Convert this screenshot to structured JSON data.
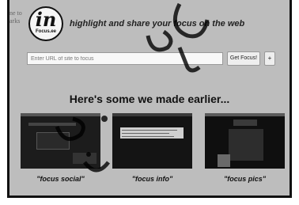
{
  "sidebar_cut": {
    "line1": "ne to",
    "line2": "arks"
  },
  "logo": {
    "mark": "in",
    "sub": "Focus.ee"
  },
  "tagline": "highlight and share your focus on the web",
  "url_input": {
    "placeholder": "Enter URL of site to focus"
  },
  "buttons": {
    "go": "Get Focus!",
    "plus": "+"
  },
  "section": {
    "heading": "Here's some we made earlier..."
  },
  "examples": [
    {
      "caption": "\"focus social\""
    },
    {
      "caption": "\"focus info\""
    },
    {
      "caption": "\"focus pics\""
    }
  ]
}
